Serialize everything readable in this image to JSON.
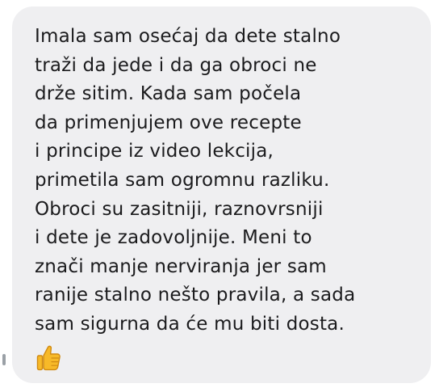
{
  "message": {
    "lines": [
      "Imala sam osećaj da dete stalno",
      "traži da jede i da ga obroci ne",
      "drže sitim. Kada sam počela",
      "da primenjujem ove recepte",
      "i principe iz video lekcija,",
      "primetila sam ogromnu razliku.",
      "Obroci su zasitniji, raznovrsniji",
      "i dete je zadovoljnije. Meni to",
      "znači manje nerviranja jer sam",
      "ranije stalno nešto pravila, a sada",
      "sam sigurna da će mu biti dosta."
    ],
    "emoji": "thumbs-up-icon"
  },
  "colors": {
    "bubble_background": "#efeff1",
    "text": "#1b1b1d",
    "emoji_yellow": "#f7b928",
    "emoji_outline": "#d08a12"
  }
}
